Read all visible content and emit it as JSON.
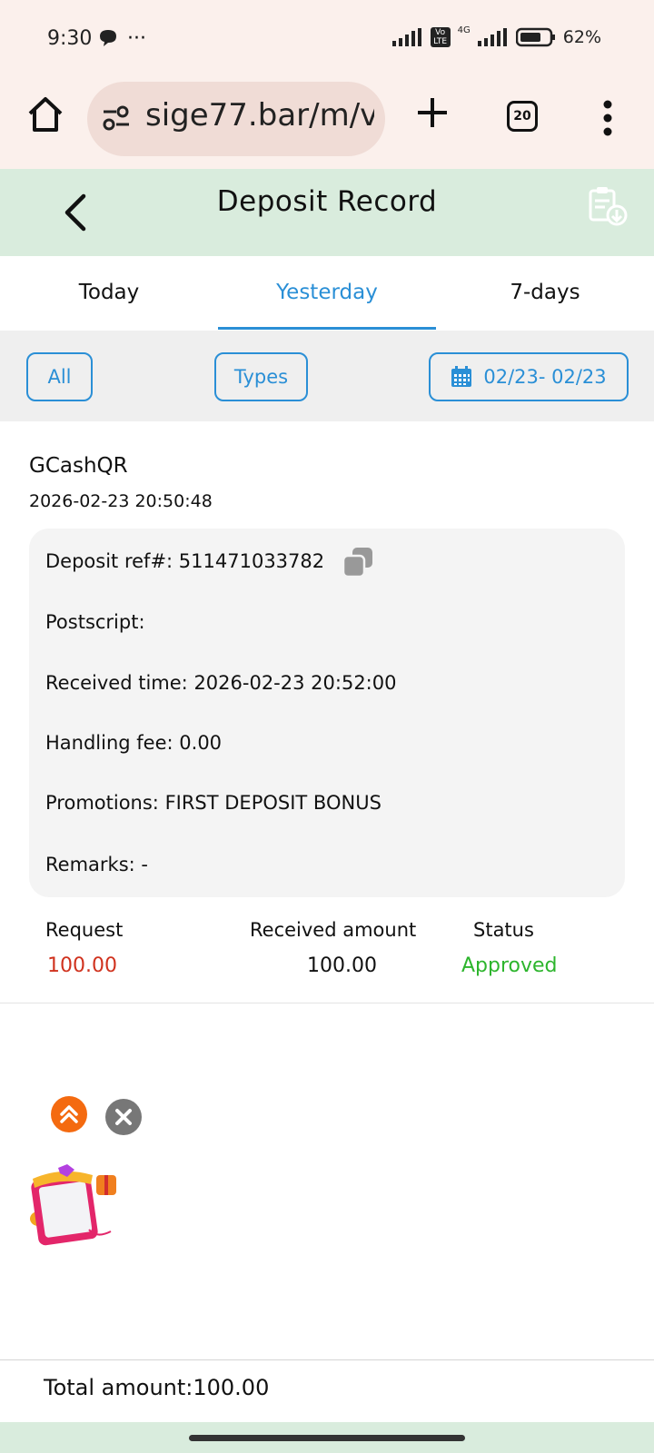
{
  "status_bar": {
    "time": "9:30",
    "chat_icon": "chat-bubble-icon",
    "more_dots": "···",
    "volte": "Vo LTE",
    "network": "4G",
    "battery": "62%"
  },
  "browser": {
    "url": "sige77.bar/m/v",
    "tab_count": "20"
  },
  "header": {
    "title": "Deposit Record"
  },
  "tabs": [
    {
      "label": "Today"
    },
    {
      "label": "Yesterday"
    },
    {
      "label": "7-days"
    }
  ],
  "filters": {
    "all_label": "All",
    "types_label": "Types",
    "date_range": "02/23- 02/23"
  },
  "record": {
    "method": "GCashQR",
    "time": "2026-02-23 20:50:48",
    "deposit_ref_label": "Deposit ref#:",
    "deposit_ref_value": "511471033782",
    "postscript_label": "Postscript:",
    "received_time_label": "Received time:",
    "received_time_value": "2026-02-23 20:52:00",
    "handling_fee_label": "Handling fee:",
    "handling_fee_value": "0.00",
    "promotions_label": "Promotions:",
    "promotions_value": "FIRST DEPOSIT BONUS",
    "remarks_label": "Remarks:",
    "remarks_value": "-",
    "request_label": "Request",
    "request_value": "100.00",
    "received_amount_label": "Received amount",
    "received_amount_value": "100.00",
    "status_label": "Status",
    "status_value": "Approved"
  },
  "footer": {
    "total": "Total amount:100.00"
  },
  "colors": {
    "accent": "#2a8fd6",
    "header_bg": "#d9ecdd",
    "request_red": "#d0321e",
    "approved_green": "#2db52d"
  }
}
